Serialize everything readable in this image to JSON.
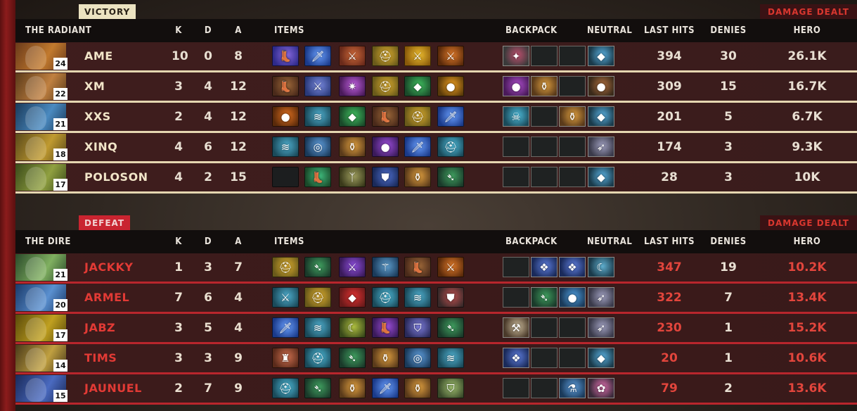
{
  "radiant": {
    "result_tag": "VICTORY",
    "team_label": "THE RADIANT",
    "damage_label": "DAMAGE DEALT",
    "columns": {
      "k": "K",
      "d": "D",
      "a": "A",
      "items": "ITEMS",
      "backpack": "BACKPACK",
      "neutral": "NEUTRAL",
      "last_hits": "LAST HITS",
      "denies": "DENIES",
      "hero": "HERO"
    },
    "players": [
      {
        "name": "AME",
        "level": "24",
        "k": "10",
        "d": "0",
        "a": "8",
        "last_hits": "394",
        "denies": "30",
        "hero_damage": "26.1K",
        "portrait": [
          "#6a3a1a",
          "#c27a2e"
        ],
        "items": [
          [
            "#2e2a8a",
            "#8a6ae0",
            "boots-icon"
          ],
          [
            "#1a3a8a",
            "#6aa0ff",
            "dagger-icon"
          ],
          [
            "#6a2a1a",
            "#d06a3a",
            "weapon-icon"
          ],
          [
            "#6a5a1a",
            "#e0b030",
            "helm-icon"
          ],
          [
            "#8a5a0a",
            "#f0c030",
            "blade-icon"
          ],
          [
            "#5a2a0a",
            "#e07a2a",
            "sword-icon"
          ]
        ],
        "backpack": [
          [
            "#3a3a3a",
            "#c05070",
            "charm-icon"
          ],
          null,
          null
        ],
        "neutral": [
          "#1a3a4a",
          "#5ab0e0",
          "rune-icon"
        ]
      },
      {
        "name": "XM",
        "level": "22",
        "k": "3",
        "d": "4",
        "a": "12",
        "last_hits": "309",
        "denies": "15",
        "hero_damage": "16.7K",
        "portrait": [
          "#5a3a1a",
          "#c08040"
        ],
        "items": [
          [
            "#4a2a1a",
            "#a06a3a",
            "boots-icon"
          ],
          [
            "#2a3a7a",
            "#7a8ae0",
            "blade-icon"
          ],
          [
            "#4a1a5a",
            "#c060e0",
            "star-icon"
          ],
          [
            "#6a5a1a",
            "#e0b030",
            "helm-icon"
          ],
          [
            "#1a4a2a",
            "#40c060",
            "gem-icon"
          ],
          [
            "#5a3a0a",
            "#f0a020",
            "orb-icon"
          ]
        ],
        "backpack": [
          [
            "#4a1a5a",
            "#b050d0",
            "orb-icon"
          ],
          [
            "#5a3a1a",
            "#e0a040",
            "flask-icon"
          ],
          null
        ],
        "neutral": [
          "#3a2a1a",
          "#b07040",
          "seed-icon"
        ]
      },
      {
        "name": "XXS",
        "level": "21",
        "k": "2",
        "d": "4",
        "a": "12",
        "last_hits": "201",
        "denies": "5",
        "hero_damage": "6.7K",
        "portrait": [
          "#1a3a5a",
          "#4a8ac0"
        ],
        "items": [
          [
            "#5a2a0a",
            "#e07020",
            "orb-icon"
          ],
          [
            "#1a4a5a",
            "#50b0d0",
            "wave-icon"
          ],
          [
            "#1a4a2a",
            "#40c060",
            "gem-icon"
          ],
          [
            "#4a2a1a",
            "#a06a3a",
            "boots-icon"
          ],
          [
            "#6a5a1a",
            "#e0b030",
            "helm-icon"
          ],
          [
            "#1a3a8a",
            "#6aa0ff",
            "dagger-icon"
          ]
        ],
        "backpack": [
          [
            "#1a4a5a",
            "#50c0e0",
            "skull-icon"
          ],
          null,
          [
            "#5a3a1a",
            "#e0a040",
            "flask-icon"
          ]
        ],
        "neutral": [
          "#1a3a4a",
          "#5ab0e0",
          "rune-icon"
        ]
      },
      {
        "name": "XINQ",
        "level": "18",
        "k": "4",
        "d": "6",
        "a": "12",
        "last_hits": "174",
        "denies": "3",
        "hero_damage": "9.3K",
        "portrait": [
          "#5a4a1a",
          "#c09a30"
        ],
        "items": [
          [
            "#1a4a5a",
            "#50b0d0",
            "wave-icon"
          ],
          [
            "#1a3a5a",
            "#60a0e0",
            "ring-icon"
          ],
          [
            "#5a3a1a",
            "#e0a040",
            "flask-icon"
          ],
          [
            "#3a1a5a",
            "#a050e0",
            "orb-icon"
          ],
          [
            "#1a3a8a",
            "#6aa0ff",
            "dagger-icon"
          ],
          [
            "#1a4a5a",
            "#50c0e0",
            "helm-icon"
          ]
        ],
        "backpack": [
          null,
          null,
          null
        ],
        "neutral": [
          "#3a3a4a",
          "#a0a0c0",
          "feather-icon"
        ]
      },
      {
        "name": "POLOSON",
        "level": "17",
        "k": "4",
        "d": "2",
        "a": "15",
        "last_hits": "28",
        "denies": "3",
        "hero_damage": "10K",
        "portrait": [
          "#3a4a1a",
          "#90a040"
        ],
        "items": [
          null,
          [
            "#1a4a2a",
            "#40c080",
            "boots-icon"
          ],
          [
            "#3a3a1a",
            "#a0a060",
            "staff-icon"
          ],
          [
            "#1a2a5a",
            "#5070d0",
            "armor-icon"
          ],
          [
            "#5a3a1a",
            "#e0a040",
            "flask-icon"
          ],
          [
            "#1a3a2a",
            "#40a060",
            "dart-icon"
          ]
        ],
        "backpack": [
          null,
          null,
          null
        ],
        "neutral": [
          "#1a3a4a",
          "#5ab0e0",
          "rune-icon"
        ]
      }
    ]
  },
  "dire": {
    "result_tag": "DEFEAT",
    "team_label": "THE DIRE",
    "damage_label": "DAMAGE DEALT",
    "columns": {
      "k": "K",
      "d": "D",
      "a": "A",
      "items": "ITEMS",
      "backpack": "BACKPACK",
      "neutral": "NEUTRAL",
      "last_hits": "LAST HITS",
      "denies": "DENIES",
      "hero": "HERO"
    },
    "players": [
      {
        "name": "JACKKY",
        "level": "21",
        "k": "1",
        "d": "3",
        "a": "7",
        "last_hits": "347",
        "denies": "19",
        "hero_damage": "10.2K",
        "portrait": [
          "#2a4a2a",
          "#80b060"
        ],
        "items": [
          [
            "#6a5a1a",
            "#e0b030",
            "helm-icon"
          ],
          [
            "#1a3a2a",
            "#40a060",
            "dart-icon"
          ],
          [
            "#3a1a5a",
            "#9050e0",
            "blade-icon"
          ],
          [
            "#1a3a5a",
            "#60a0d0",
            "scepter-icon"
          ],
          [
            "#4a2a1a",
            "#a06a3a",
            "boots-icon"
          ],
          [
            "#5a2a0a",
            "#e07a2a",
            "sword-icon"
          ]
        ],
        "backpack": [
          null,
          [
            "#1a2a5a",
            "#6080e0",
            "crystal-icon"
          ],
          [
            "#1a2a5a",
            "#6080e0",
            "crystal-icon"
          ]
        ],
        "neutral": [
          "#1a3a4a",
          "#60b0d0",
          "claw-icon"
        ]
      },
      {
        "name": "ARMEL",
        "level": "20",
        "k": "7",
        "d": "6",
        "a": "4",
        "last_hits": "322",
        "denies": "7",
        "hero_damage": "13.4K",
        "portrait": [
          "#1a3a6a",
          "#5a90d0"
        ],
        "items": [
          [
            "#1a4a5a",
            "#50b0d0",
            "sword-icon"
          ],
          [
            "#6a5a1a",
            "#e0b030",
            "helm-icon"
          ],
          [
            "#6a1a1a",
            "#e03030",
            "gem-icon"
          ],
          [
            "#1a4a5a",
            "#50c0e0",
            "helm-icon"
          ],
          [
            "#1a4a5a",
            "#50b0d0",
            "wave-icon"
          ],
          [
            "#3a2a2a",
            "#c05050",
            "armor-icon"
          ]
        ],
        "backpack": [
          null,
          [
            "#1a3a2a",
            "#40a060",
            "dart-icon"
          ],
          [
            "#1a3a5a",
            "#50a0e0",
            "orb-icon"
          ]
        ],
        "neutral": [
          "#3a3a4a",
          "#a0a0c0",
          "feather-icon"
        ]
      },
      {
        "name": "JABZ",
        "level": "17",
        "k": "3",
        "d": "5",
        "a": "4",
        "last_hits": "230",
        "denies": "1",
        "hero_damage": "15.2K",
        "portrait": [
          "#5a4a0a",
          "#c0a020"
        ],
        "items": [
          [
            "#1a3a8a",
            "#6aa0ff",
            "dagger-icon"
          ],
          [
            "#1a4a5a",
            "#50b0d0",
            "wave-icon"
          ],
          [
            "#3a4a1a",
            "#b0c040",
            "claw-icon"
          ],
          [
            "#3a1a5a",
            "#a050e0",
            "boots-icon"
          ],
          [
            "#2a2a5a",
            "#8080e0",
            "shield-icon"
          ],
          [
            "#1a3a2a",
            "#40a060",
            "dart-icon"
          ]
        ],
        "backpack": [
          [
            "#4a3a2a",
            "#d0c0a0",
            "axe-icon"
          ],
          null,
          null
        ],
        "neutral": [
          "#3a3a4a",
          "#a0a0c0",
          "feather-icon"
        ]
      },
      {
        "name": "TIMS",
        "level": "14",
        "k": "3",
        "d": "3",
        "a": "9",
        "last_hits": "20",
        "denies": "1",
        "hero_damage": "10.6K",
        "portrait": [
          "#4a3a1a",
          "#c0a040"
        ],
        "items": [
          [
            "#5a2a1a",
            "#d07050",
            "idol-icon"
          ],
          [
            "#1a4a5a",
            "#50c0e0",
            "helm-icon"
          ],
          [
            "#1a3a2a",
            "#40a060",
            "dart-icon"
          ],
          [
            "#5a3a1a",
            "#e0a040",
            "flask-icon"
          ],
          [
            "#1a3a5a",
            "#60a0e0",
            "ring-icon"
          ],
          [
            "#1a4a5a",
            "#50b0d0",
            "wave-icon"
          ]
        ],
        "backpack": [
          [
            "#1a2a5a",
            "#6080e0",
            "crystal-icon"
          ],
          null,
          null
        ],
        "neutral": [
          "#1a3a4a",
          "#5ab0e0",
          "rune-icon"
        ]
      },
      {
        "name": "JAUNUEL",
        "level": "15",
        "k": "2",
        "d": "7",
        "a": "9",
        "last_hits": "79",
        "denies": "2",
        "hero_damage": "13.6K",
        "portrait": [
          "#1a2a5a",
          "#4a6ac0"
        ],
        "items": [
          [
            "#1a4a5a",
            "#50c0e0",
            "helm-icon"
          ],
          [
            "#1a3a2a",
            "#40a060",
            "dart-icon"
          ],
          [
            "#5a3a1a",
            "#e0a040",
            "flask-icon"
          ],
          [
            "#1a3a8a",
            "#6aa0ff",
            "dagger-icon"
          ],
          [
            "#5a3a1a",
            "#e0a040",
            "flask-icon"
          ],
          [
            "#3a4a2a",
            "#a0c070",
            "shield-icon"
          ]
        ],
        "backpack": [
          null,
          null,
          [
            "#1a3a5a",
            "#60a0e0",
            "vial-icon"
          ]
        ],
        "neutral": [
          "#3a2a3a",
          "#e070b0",
          "flower-icon"
        ]
      }
    ]
  }
}
